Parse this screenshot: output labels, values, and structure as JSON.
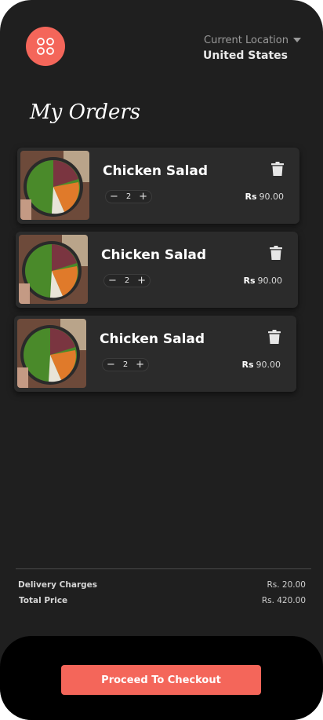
{
  "header": {
    "menu_icon": "grid-icon",
    "location_label": "Current Location",
    "location_value": "United States"
  },
  "page": {
    "title": "My Orders"
  },
  "orders": [
    {
      "name": "Chicken Salad",
      "quantity": "2",
      "currency": "Rs",
      "price": "90.00",
      "image": "chicken-salad-bowl"
    },
    {
      "name": "Chicken Salad",
      "quantity": "2",
      "currency": "Rs",
      "price": "90.00",
      "image": "chicken-salad-bowl"
    },
    {
      "name": "Chicken Salad",
      "quantity": "2",
      "currency": "Rs",
      "price": "90.00",
      "image": "chicken-salad-bowl"
    }
  ],
  "summary": {
    "delivery_label": "Delivery Charges",
    "delivery_value": "Rs. 20.00",
    "total_label": "Total Price",
    "total_value": "Rs. 420.00"
  },
  "footer": {
    "checkout_label": "Proceed To Checkout"
  },
  "colors": {
    "accent": "#f4665a",
    "background": "#1f1f1f",
    "card": "#2b2b2b"
  }
}
